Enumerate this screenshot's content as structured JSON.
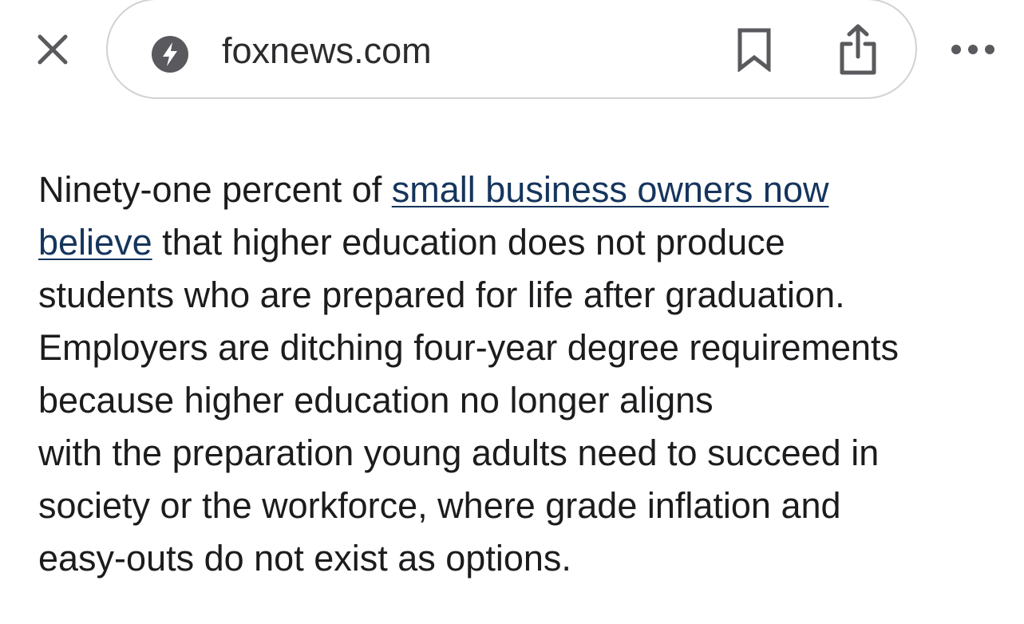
{
  "toolbar": {
    "close_icon": "close-icon",
    "url": "foxnews.com",
    "amp_icon": "lightning-bolt-icon",
    "bookmark_icon": "bookmark-icon",
    "share_icon": "share-icon",
    "more_icon": "more-dots-icon"
  },
  "article": {
    "lines": [
      "Ninety-one percent of ",
      " that higher education does not produce",
      "students who are prepared for life after graduation.",
      "Employers are ditching four-year degree requirements",
      "because higher education no longer aligns",
      "with the preparation young adults need to succeed in",
      "society or the workforce, where grade inflation and",
      "easy-outs do not exist as options."
    ],
    "link_part1": "small business owners now",
    "link_part2": "believe"
  },
  "colors": {
    "text": "#1c1c1e",
    "link": "#15355d",
    "border": "#d1d1d6",
    "icon": "#5a5a5e"
  }
}
